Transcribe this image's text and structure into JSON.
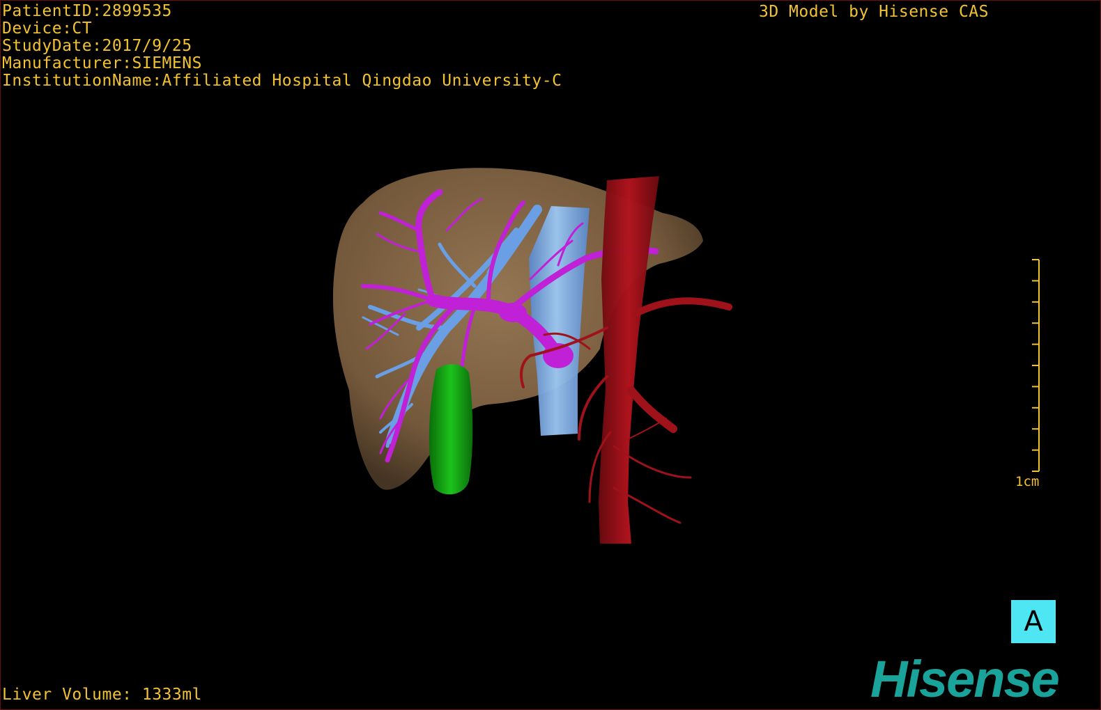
{
  "header": {
    "patient_id": "PatientID:2899535",
    "device": "Device:CT",
    "study_date": "StudyDate:2017/9/25",
    "manufacturer": "Manufacturer:SIEMENS",
    "institution": "InstitutionName:Affiliated Hospital Qingdao University-C",
    "model_credit": "3D Model by Hisense CAS"
  },
  "footer": {
    "liver_volume": "Liver Volume: 1333ml"
  },
  "scale": {
    "label": "1cm",
    "tick_count": 10
  },
  "orientation": {
    "label": "A"
  },
  "brand": {
    "logo_text": "Hisense",
    "color": "#1aa39a"
  },
  "colors": {
    "overlay_text": "#f2c230",
    "liver": "#8a6a43",
    "hepatic_vein": "#c020d6",
    "portal_vein": "#6a9fe6",
    "vena_cava": "#7fb7ee",
    "aorta": "#a0121a",
    "gallbladder": "#0fa20f",
    "orientation_marker": "#4ee6f3"
  },
  "structures": [
    "liver",
    "hepatic-vein",
    "portal-vein",
    "inferior-vena-cava",
    "aorta",
    "gallbladder"
  ]
}
